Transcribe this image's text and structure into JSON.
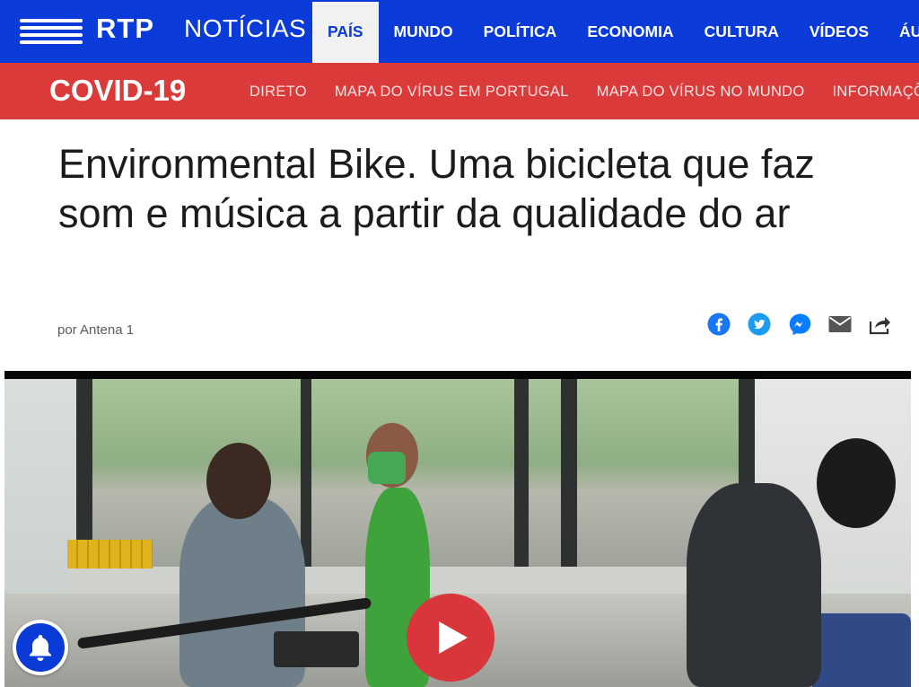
{
  "brand": {
    "rtp": "RTP",
    "noticias": "NOTÍCIAS"
  },
  "nav": {
    "items": [
      {
        "label": "PAÍS",
        "active": true
      },
      {
        "label": "MUNDO",
        "active": false
      },
      {
        "label": "POLÍTICA",
        "active": false
      },
      {
        "label": "ECONOMIA",
        "active": false
      },
      {
        "label": "CULTURA",
        "active": false
      },
      {
        "label": "VÍDEOS",
        "active": false
      },
      {
        "label": "ÁUDIOS",
        "active": false
      }
    ]
  },
  "covid": {
    "title": "COVID-19",
    "links": [
      "DIRETO",
      "MAPA DO VÍRUS EM PORTUGAL",
      "MAPA DO VÍRUS NO MUNDO",
      "INFORMAÇÕES"
    ]
  },
  "article": {
    "headline": "Environmental Bike. Uma bicicleta que faz som e música a partir da qualidade do ar",
    "byline": "por Antena 1"
  },
  "share": {
    "icons": [
      "facebook-icon",
      "twitter-icon",
      "messenger-icon",
      "email-icon",
      "share-icon"
    ]
  },
  "colors": {
    "nav_bg": "#0a3ad8",
    "covid_bg": "#db3a3a",
    "play_button": "#d8363a",
    "facebook": "#1877f2",
    "twitter": "#1d9bf0",
    "messenger": "#0a7cff",
    "email": "#555555"
  }
}
